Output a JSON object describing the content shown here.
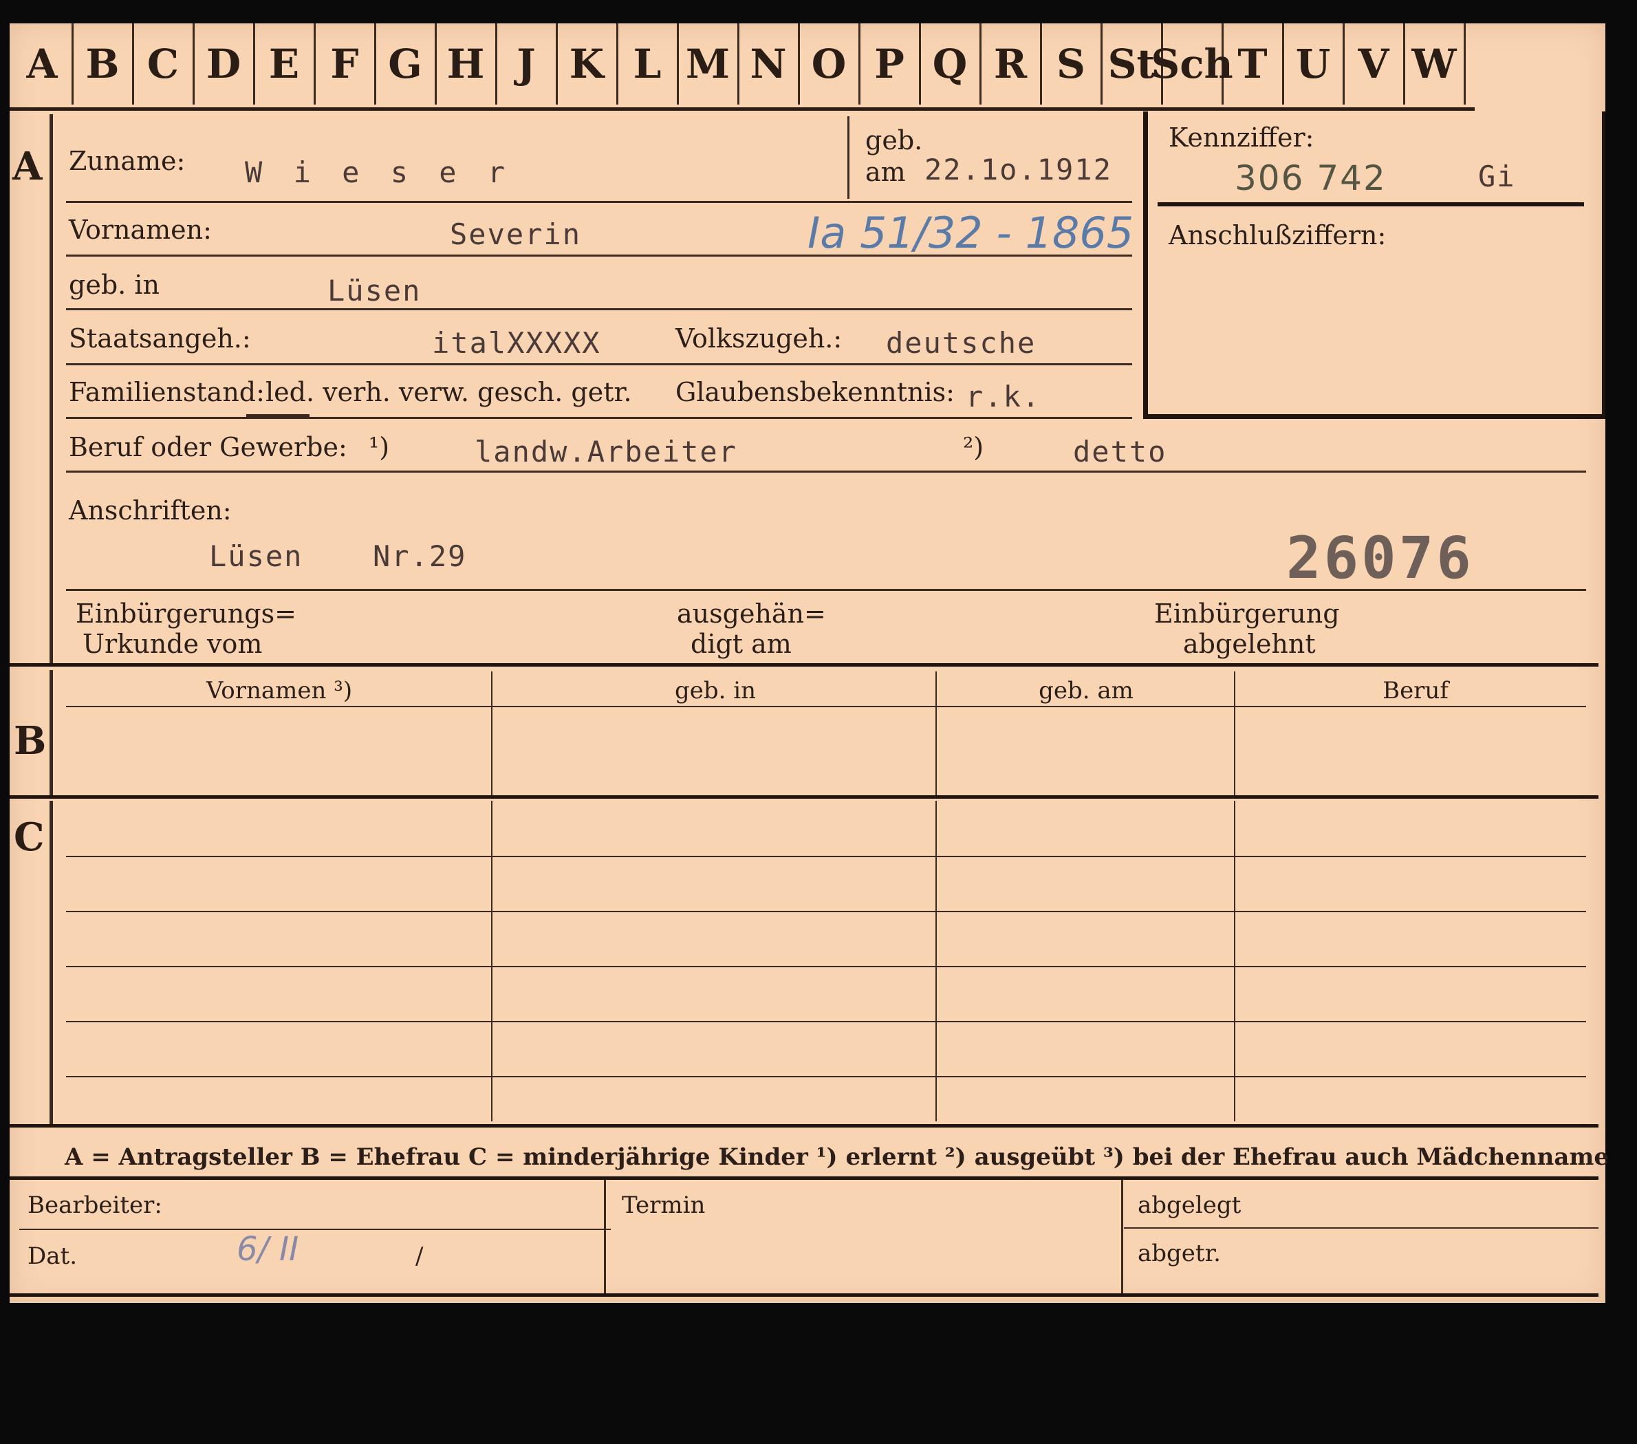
{
  "tabs": [
    "A",
    "B",
    "C",
    "D",
    "E",
    "F",
    "G",
    "H",
    "J",
    "K",
    "L",
    "M",
    "N",
    "O",
    "P",
    "Q",
    "R",
    "S",
    "St",
    "Sch",
    "T",
    "U",
    "V",
    "W"
  ],
  "sections": {
    "a": "A",
    "b": "B",
    "c": "C"
  },
  "labels": {
    "zuname": "Zuname:",
    "geb": "geb.",
    "am": "am",
    "vornamen": "Vornamen:",
    "geb_in": "geb. in",
    "staatsangeh": "Staatsangeh.:",
    "volkszugeh": "Volkszugeh.:",
    "familienstand": "Familienstand:",
    "familienstand_options": "led. verh. verw. gesch. getr.",
    "glaubensbekenntnis": "Glaubensbekenntnis:",
    "beruf": "Beruf oder Gewerbe:",
    "beruf_note1": "¹)",
    "beruf_note2": "²)",
    "anschriften": "Anschriften:",
    "einbuergerungs1": "Einbürgerungs=",
    "einbuergerungs2": "Urkunde vom",
    "ausgehaen1": "ausgehän=",
    "ausgehaen2": "digt am",
    "einbuergerung1": "Einbürgerung",
    "einbuergerung2": "abgelehnt",
    "kennziffer": "Kennziffer:",
    "anschlussziffern": "Anschlußziffern:",
    "bearbeiter": "Bearbeiter:",
    "dat": "Dat.",
    "termin": "Termin",
    "abgelegt": "abgelegt",
    "abgetr": "abgetr."
  },
  "values": {
    "zuname": "W i e s e r",
    "geb_am": "22.1o.1912",
    "vornamen": "Severin",
    "handwritten_ref": "Ia 51/32 - 1865",
    "geb_in": "Lüsen",
    "staatsangeh": "italXXXXX",
    "volkszugeh": "deutsche",
    "glaubensbekenntnis": "r.k.",
    "beruf_erlernt": "landw.Arbeiter",
    "beruf_ausgeuebt": "detto",
    "anschrift_ort": "Lüsen",
    "anschrift_nr": "Nr.29",
    "stamp_number": "26076",
    "kennziffer_num": "306 742",
    "kennziffer_code": "Gi",
    "dat_hand": "6/ II",
    "dat_slash": "/"
  },
  "table": {
    "headers": [
      "Vornamen ³)",
      "geb. in",
      "geb. am",
      "Beruf"
    ]
  },
  "legend": "A = Antragsteller   B = Ehefrau   C = minderjährige Kinder   ¹) erlernt   ²) ausgeübt   ³) bei der Ehefrau auch Mädchenname"
}
